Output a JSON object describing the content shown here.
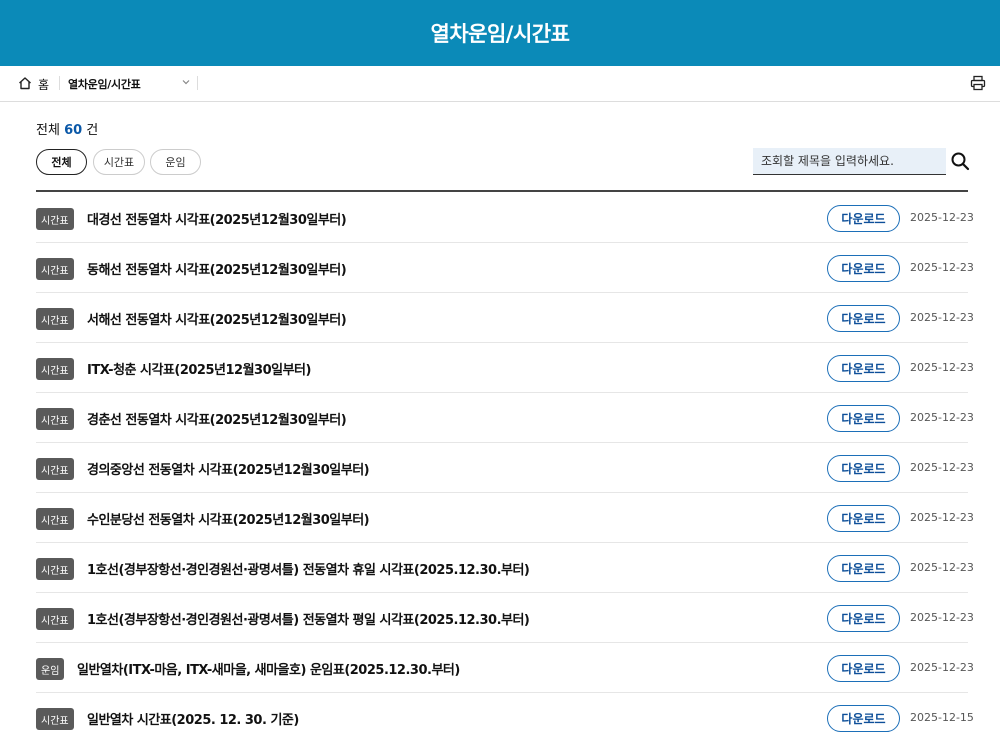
{
  "header": {
    "title": "열차운임/시간표"
  },
  "breadcrumb": {
    "home": "홈",
    "current": "열차운임/시간표"
  },
  "summary": {
    "prefix": "전체",
    "count": "60",
    "suffix": "건"
  },
  "filters": [
    {
      "label": "전체",
      "active": true
    },
    {
      "label": "시간표",
      "active": false
    },
    {
      "label": "운임",
      "active": false
    }
  ],
  "search": {
    "placeholder": "조회할 제목을 입력하세요."
  },
  "download_label": "다운로드",
  "items": [
    {
      "badge": "시간표",
      "title": "대경선 전동열차 시각표(2025년12월30일부터)",
      "date": "2025-12-23"
    },
    {
      "badge": "시간표",
      "title": "동해선 전동열차 시각표(2025년12월30일부터)",
      "date": "2025-12-23"
    },
    {
      "badge": "시간표",
      "title": "서해선 전동열차 시각표(2025년12월30일부터)",
      "date": "2025-12-23"
    },
    {
      "badge": "시간표",
      "title": "ITX-청춘 시각표(2025년12월30일부터)",
      "date": "2025-12-23"
    },
    {
      "badge": "시간표",
      "title": "경춘선 전동열차 시각표(2025년12월30일부터)",
      "date": "2025-12-23"
    },
    {
      "badge": "시간표",
      "title": "경의중앙선 전동열차 시각표(2025년12월30일부터)",
      "date": "2025-12-23"
    },
    {
      "badge": "시간표",
      "title": "수인분당선 전동열차 시각표(2025년12월30일부터)",
      "date": "2025-12-23"
    },
    {
      "badge": "시간표",
      "title": "1호선(경부장항선·경인경원선·광명셔틀) 전동열차 휴일 시각표(2025.12.30.부터)",
      "date": "2025-12-23"
    },
    {
      "badge": "시간표",
      "title": "1호선(경부장항선·경인경원선·광명셔틀) 전동열차 평일 시각표(2025.12.30.부터)",
      "date": "2025-12-23"
    },
    {
      "badge": "운임",
      "title": "일반열차(ITX-마음, ITX-새마을, 새마을호) 운임표(2025.12.30.부터)",
      "date": "2025-12-23"
    },
    {
      "badge": "시간표",
      "title": "일반열차 시간표(2025. 12. 30. 기준)",
      "date": "2025-12-15"
    }
  ]
}
